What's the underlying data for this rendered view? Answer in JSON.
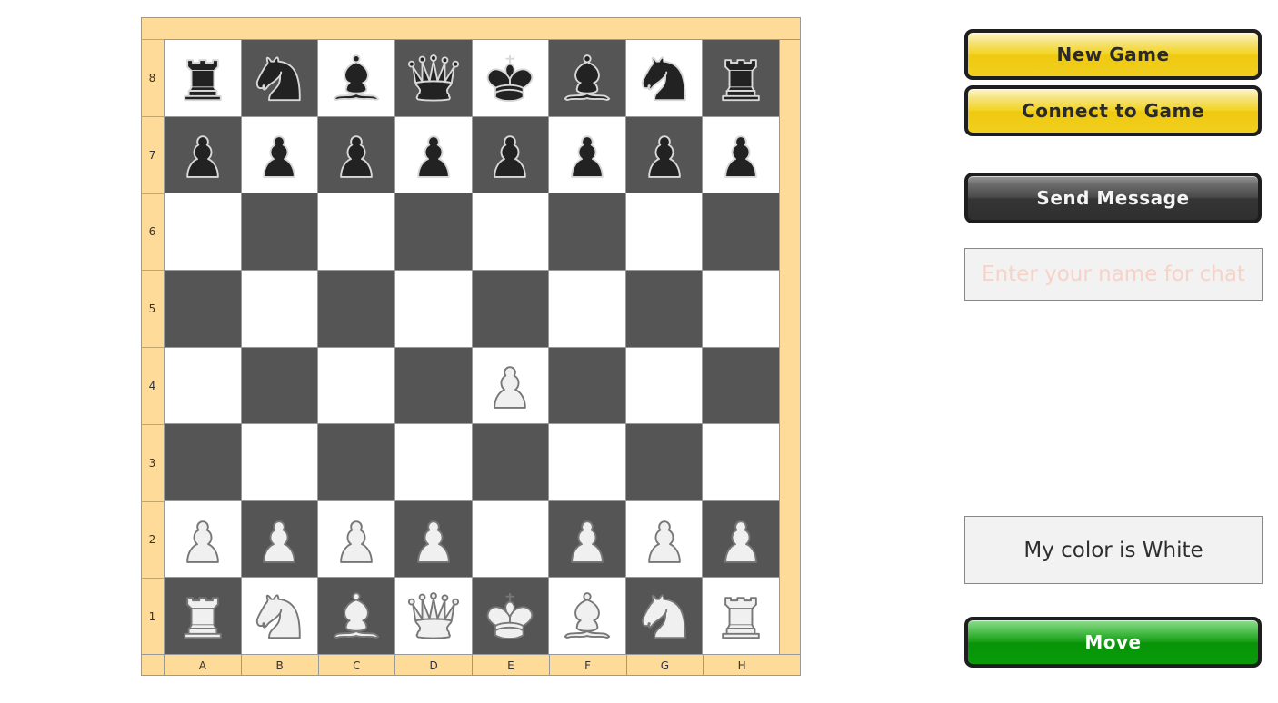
{
  "board": {
    "files": [
      "A",
      "B",
      "C",
      "D",
      "E",
      "F",
      "G",
      "H"
    ],
    "ranks": [
      "8",
      "7",
      "6",
      "5",
      "4",
      "3",
      "2",
      "1"
    ],
    "colors": {
      "light_square": "#ffffff",
      "dark_square": "#555555",
      "frame": "#ffdb99",
      "white_piece": "#f0f0f0",
      "black_piece": "#222222"
    },
    "position": [
      [
        "bR",
        "bN",
        "bB",
        "bQ",
        "bK",
        "bB",
        "bN",
        "bR"
      ],
      [
        "bP",
        "bP",
        "bP",
        "bP",
        "bP",
        "bP",
        "bP",
        "bP"
      ],
      [
        "",
        "",
        "",
        "",
        "",
        "",
        "",
        ""
      ],
      [
        "",
        "",
        "",
        "",
        "",
        "",
        "",
        ""
      ],
      [
        "",
        "",
        "",
        "",
        "wP",
        "",
        "",
        ""
      ],
      [
        "",
        "",
        "",
        "",
        "",
        "",
        "",
        ""
      ],
      [
        "wP",
        "wP",
        "wP",
        "wP",
        "",
        "wP",
        "wP",
        "wP"
      ],
      [
        "wR",
        "wN",
        "wB",
        "wQ",
        "wK",
        "wB",
        "wN",
        "wR"
      ]
    ],
    "piece_names": {
      "K": "king",
      "Q": "queen",
      "R": "rook",
      "B": "bishop",
      "N": "knight",
      "P": "pawn"
    }
  },
  "panel": {
    "new_game_label": "New Game",
    "connect_label": "Connect to Game",
    "send_message_label": "Send Message",
    "name_input_placeholder": "Enter your name for chat",
    "name_input_value": "",
    "color_status": "My color is White",
    "move_label": "Move"
  }
}
